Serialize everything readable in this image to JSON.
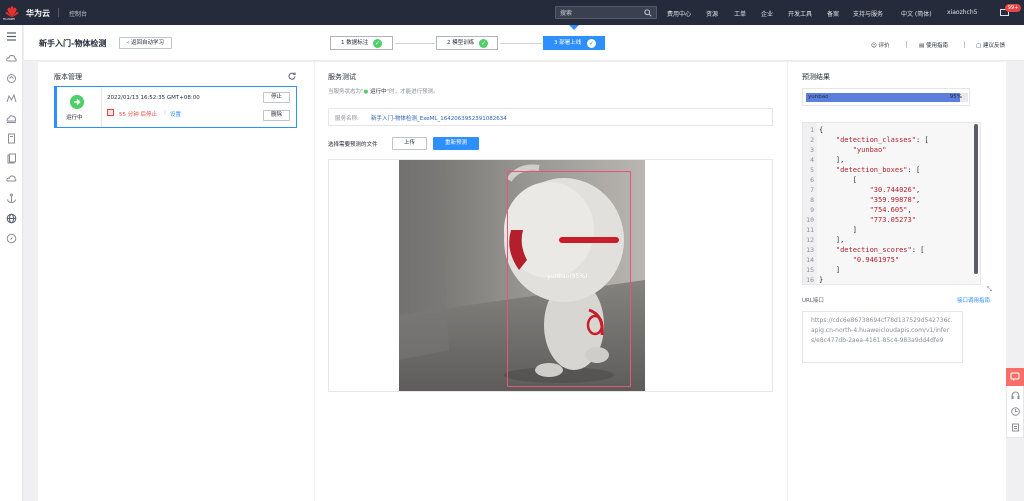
{
  "topbar": {
    "logo_text": "HUAWEI",
    "brand": "华为云",
    "console": "控制台",
    "search_placeholder": "搜索",
    "nav": [
      "费用中心",
      "资源",
      "工单",
      "企业",
      "开发工具",
      "备案",
      "支持与服务",
      "中文 (简体)",
      "xiaozhch5"
    ],
    "mail_badge": "99+"
  },
  "header": {
    "title": "新手入门-物体检测",
    "back_label": "返回自动学习",
    "steps": [
      {
        "label": "1 数据标注",
        "done": true
      },
      {
        "label": "2 模型训练",
        "done": true
      },
      {
        "label": "3 部署上线",
        "done": true,
        "active": true
      }
    ],
    "actions": {
      "rate": "评价",
      "guide": "使用指南",
      "feedback": "建议反馈"
    }
  },
  "version_panel": {
    "title": "版本管理",
    "status": "运行中",
    "timestamp": "2022/01/13 16:52:35 GMT+08:00",
    "countdown": "55 分钟 后停止",
    "setting": "设置",
    "stop_btn": "停止",
    "delete_btn": "删除"
  },
  "service_test": {
    "title": "服务测试",
    "status_prefix": "当服务状态为\"",
    "status_value": "运行中",
    "status_suffix": "\"时，才能进行预测。",
    "name_label": "服务名称:",
    "name_value": "新手入门-物体检测_ExeML_1642063952391082634",
    "file_label": "选择需要预测的文件",
    "upload_btn": "上传",
    "predict_btn": "重新预测",
    "detection_label": "yunbao(95%)"
  },
  "results": {
    "title": "预测结果",
    "bar_name": "yunbao",
    "bar_value": "95%",
    "bar_fraction": 0.95,
    "code_lines": [
      "{",
      "    \"detection_classes\": [",
      "        \"yunbao\"",
      "    ],",
      "    \"detection_boxes\": [",
      "        [",
      "            \"30.744026\",",
      "            \"359.99878\",",
      "            \"754.605\",",
      "            \"773.05273\"",
      "        ]",
      "    ],",
      "    \"detection_scores\": [",
      "        \"0.9461975\"",
      "    ]",
      "}"
    ],
    "url_label": "URL接口",
    "url_doc_link": "接口调用指南",
    "url_value": "https://cdc6e86738694cf78d137529d542736c.apig.cn-north-4.huaweicloudapis.com/v1/infers/e8c477db-2aea-4161-85c4-983a9dd4dfe9"
  },
  "colors": {
    "accent": "#2e8fff",
    "success": "#4fcf6a",
    "danger": "#e54545",
    "topbar": "#252b3a",
    "bbox": "#e8557a"
  }
}
